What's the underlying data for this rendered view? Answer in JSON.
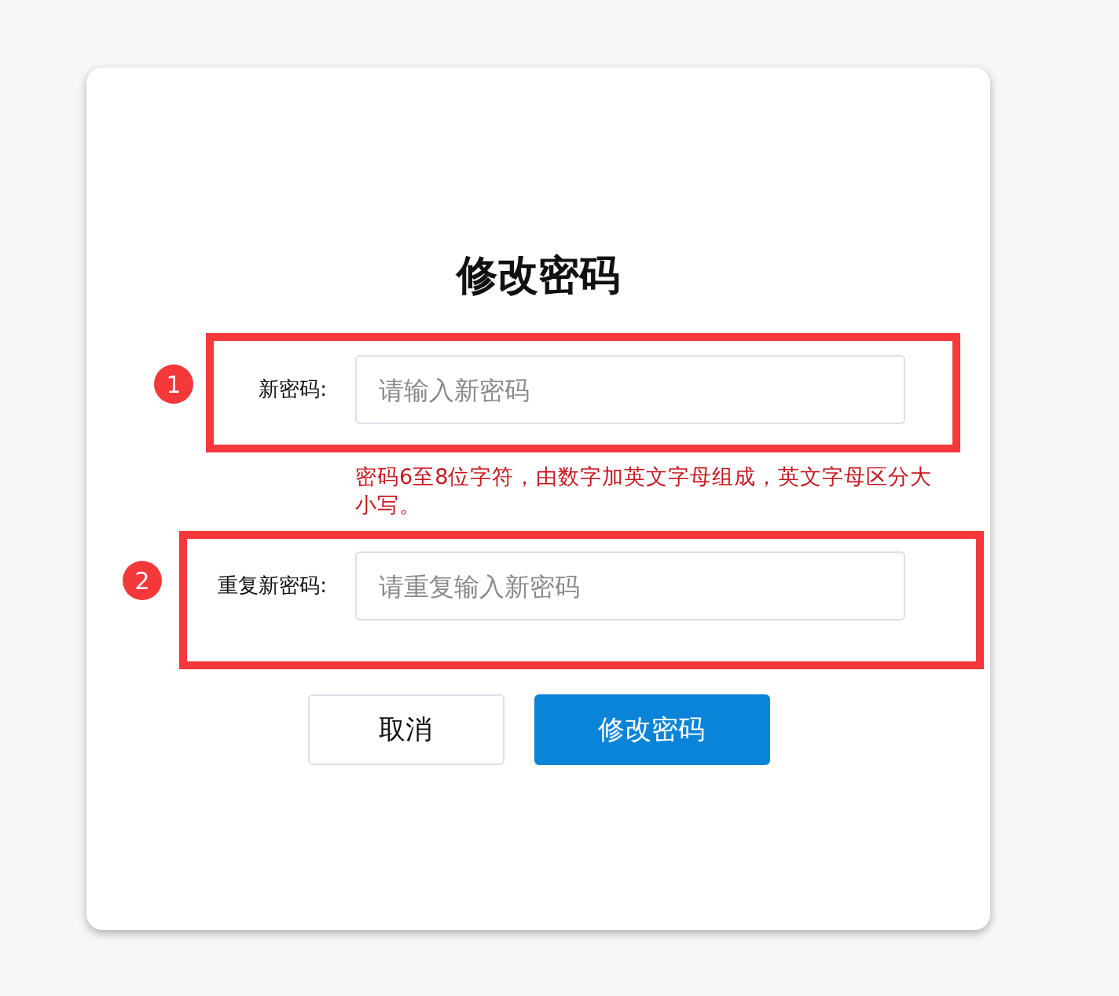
{
  "title": "修改密码",
  "fields": [
    {
      "label": "新密码:",
      "placeholder": "请输入新密码",
      "hint": "密码6至8位字符，由数字加英文字母组成，英文字母区分大小写。"
    },
    {
      "label": "重复新密码:",
      "placeholder": "请重复输入新密码"
    }
  ],
  "buttons": [
    {
      "kind": "secondary",
      "label": "取消"
    },
    {
      "kind": "primary",
      "label": "修改密码"
    }
  ],
  "annotations": [
    {
      "number": "1"
    },
    {
      "number": "2"
    }
  ]
}
